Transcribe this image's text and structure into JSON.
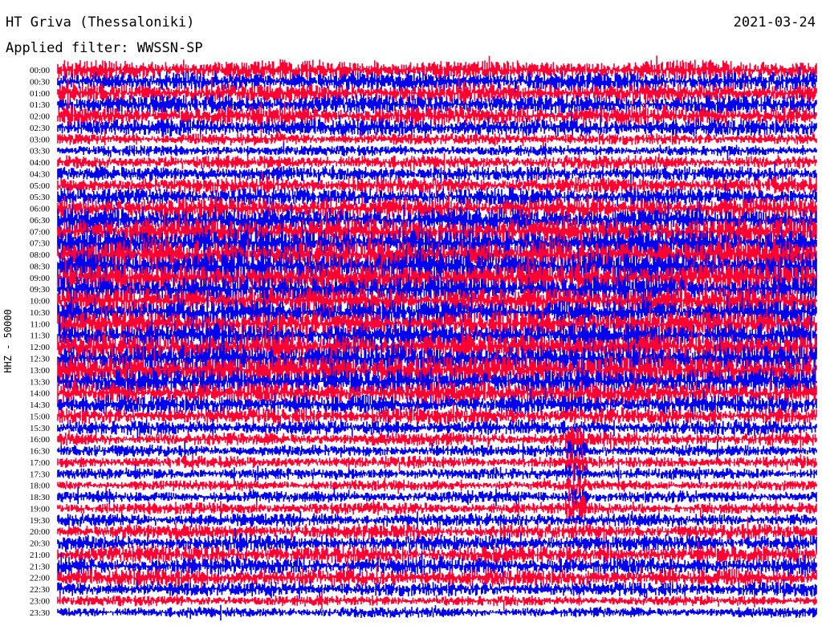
{
  "header": {
    "station": "HT Griva (Thessaloniki)",
    "date": "2021-03-24",
    "filter": "Applied filter: WWSSN-SP"
  },
  "chart_data": {
    "type": "line",
    "title": "HT Griva (Thessaloniki)",
    "subtitle": "Applied filter: WWSSN-SP",
    "ylabel": "HHZ - 50000",
    "xlabel": "",
    "time_labels": [
      "00:00",
      "00:30",
      "01:00",
      "01:30",
      "02:00",
      "02:30",
      "03:00",
      "03:30",
      "04:00",
      "04:30",
      "05:00",
      "05:30",
      "06:00",
      "06:30",
      "07:00",
      "07:30",
      "08:00",
      "08:30",
      "09:00",
      "09:30",
      "10:00",
      "10:30",
      "11:00",
      "11:30",
      "12:00",
      "12:30",
      "13:00",
      "13:30",
      "14:00",
      "14:30",
      "15:00",
      "15:30",
      "16:00",
      "16:30",
      "17:00",
      "17:30",
      "18:00",
      "18:30",
      "19:00",
      "19:30",
      "20:00",
      "20:30",
      "21:00",
      "21:30",
      "22:00",
      "22:30",
      "23:00",
      "23:30"
    ],
    "trace_colors": [
      "#ff0033",
      "#0000ee"
    ],
    "amplitude_profile": [
      1.3,
      1.3,
      1.3,
      1.3,
      1.3,
      1.2,
      0.8,
      0.7,
      0.9,
      1.0,
      1.1,
      1.2,
      1.5,
      1.6,
      1.8,
      1.9,
      2.0,
      2.0,
      1.9,
      1.8,
      1.8,
      1.7,
      1.7,
      1.7,
      1.8,
      1.9,
      2.0,
      1.7,
      1.5,
      1.3,
      1.1,
      1.0,
      0.9,
      0.8,
      0.8,
      0.8,
      0.7,
      0.8,
      0.8,
      0.9,
      1.0,
      1.1,
      1.2,
      1.2,
      1.2,
      1.0,
      0.7,
      0.7
    ],
    "events": [
      {
        "time_label": "17:30",
        "description": ""
      }
    ]
  }
}
